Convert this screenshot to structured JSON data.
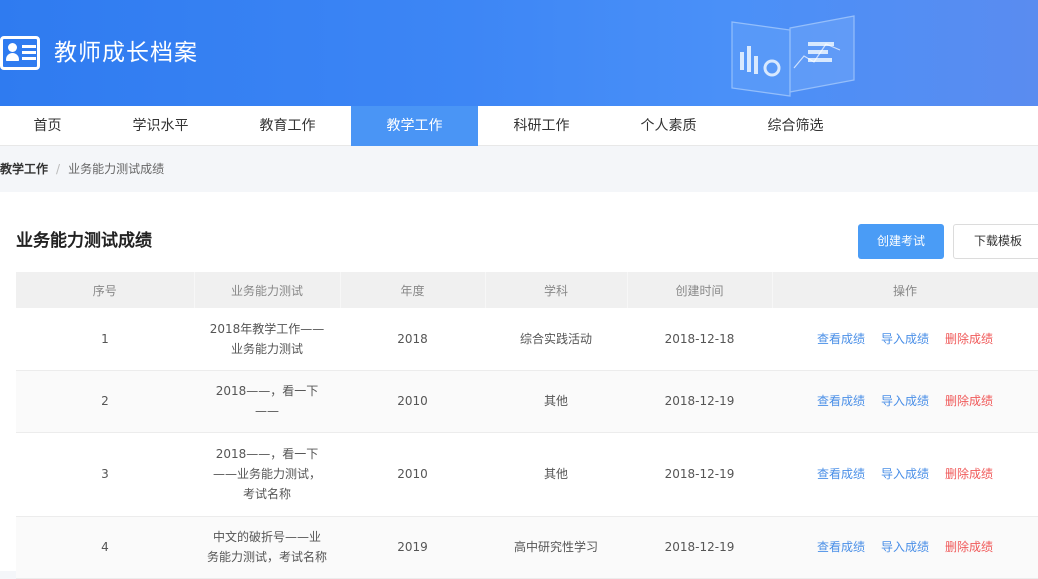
{
  "header": {
    "title": "教师成长档案"
  },
  "nav": [
    "首页",
    "学识水平",
    "教育工作",
    "教学工作",
    "科研工作",
    "个人素质",
    "综合筛选"
  ],
  "breadcrumb": {
    "parent": "教学工作",
    "current": "业务能力测试成绩"
  },
  "panel": {
    "title": "业务能力测试成绩",
    "create_label": "创建考试",
    "download_label": "下载模板"
  },
  "table": {
    "columns": [
      "序号",
      "业务能力测试",
      "年度",
      "学科",
      "创建时间",
      "操作"
    ],
    "rows": [
      {
        "no": "1",
        "name": [
          "2018年教学工作——",
          "业务能力测试"
        ],
        "year": "2018",
        "subject": "综合实践活动",
        "created": "2018-12-18"
      },
      {
        "no": "2",
        "name": [
          "2018——，看一下",
          "——"
        ],
        "year": "2010",
        "subject": "其他",
        "created": "2018-12-19"
      },
      {
        "no": "3",
        "name": [
          "2018——，看一下",
          "——业务能力测试，",
          "考试名称"
        ],
        "year": "2010",
        "subject": "其他",
        "created": "2018-12-19"
      },
      {
        "no": "4",
        "name": [
          "中文的破折号——业",
          "务能力测试，考试名称"
        ],
        "year": "2019",
        "subject": "高中研究性学习",
        "created": "2018-12-19"
      }
    ],
    "actions": {
      "view": "查看成绩",
      "import": "导入成绩",
      "delete": "删除成绩"
    }
  },
  "colors": {
    "header_start": "#2f7bf0",
    "active_tab": "#4a95f5",
    "primary_button": "#4a9cf6",
    "link": "#4a8fe7",
    "danger": "#f05a5a"
  }
}
